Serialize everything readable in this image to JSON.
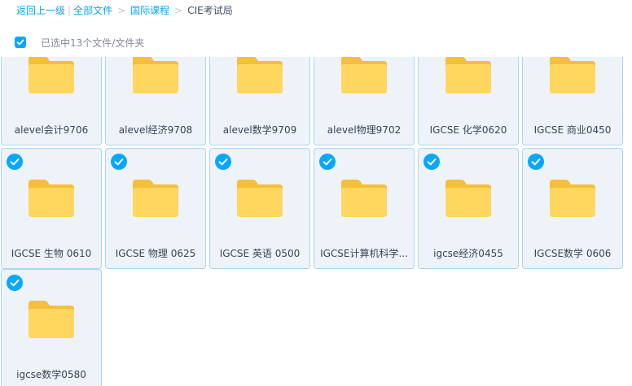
{
  "breadcrumb": {
    "back": "返回上一级",
    "all_files": "全部文件",
    "folder1": "国际课程",
    "current": "CIE考试局"
  },
  "selection": {
    "text": "已选中13个文件/文件夹"
  },
  "colors": {
    "accent": "#06a7ff",
    "folder": "#ffd65e",
    "folder_tab": "#f5bf3b",
    "card_border": "#a8d6f5",
    "card_bg": "#eef3fa"
  },
  "folders": [
    {
      "name": "alevel会计9706",
      "selected": true,
      "check_visible": false
    },
    {
      "name": "alevel经济9708",
      "selected": true,
      "check_visible": false
    },
    {
      "name": "alevel数学9709",
      "selected": true,
      "check_visible": false
    },
    {
      "name": "alevel物理9702",
      "selected": true,
      "check_visible": false
    },
    {
      "name": "IGCSE 化学0620",
      "selected": true,
      "check_visible": false
    },
    {
      "name": "IGCSE 商业0450",
      "selected": true,
      "check_visible": false
    },
    {
      "name": "IGCSE 生物 0610",
      "selected": true,
      "check_visible": true
    },
    {
      "name": "IGCSE 物理 0625",
      "selected": true,
      "check_visible": true
    },
    {
      "name": "IGCSE 英语 0500",
      "selected": true,
      "check_visible": true
    },
    {
      "name": "IGCSE计算机科学...",
      "selected": true,
      "check_visible": true
    },
    {
      "name": "igcse经济0455",
      "selected": true,
      "check_visible": true
    },
    {
      "name": "IGCSE数学 0606",
      "selected": true,
      "check_visible": true
    },
    {
      "name": "igcse数学0580",
      "selected": true,
      "check_visible": true
    }
  ]
}
